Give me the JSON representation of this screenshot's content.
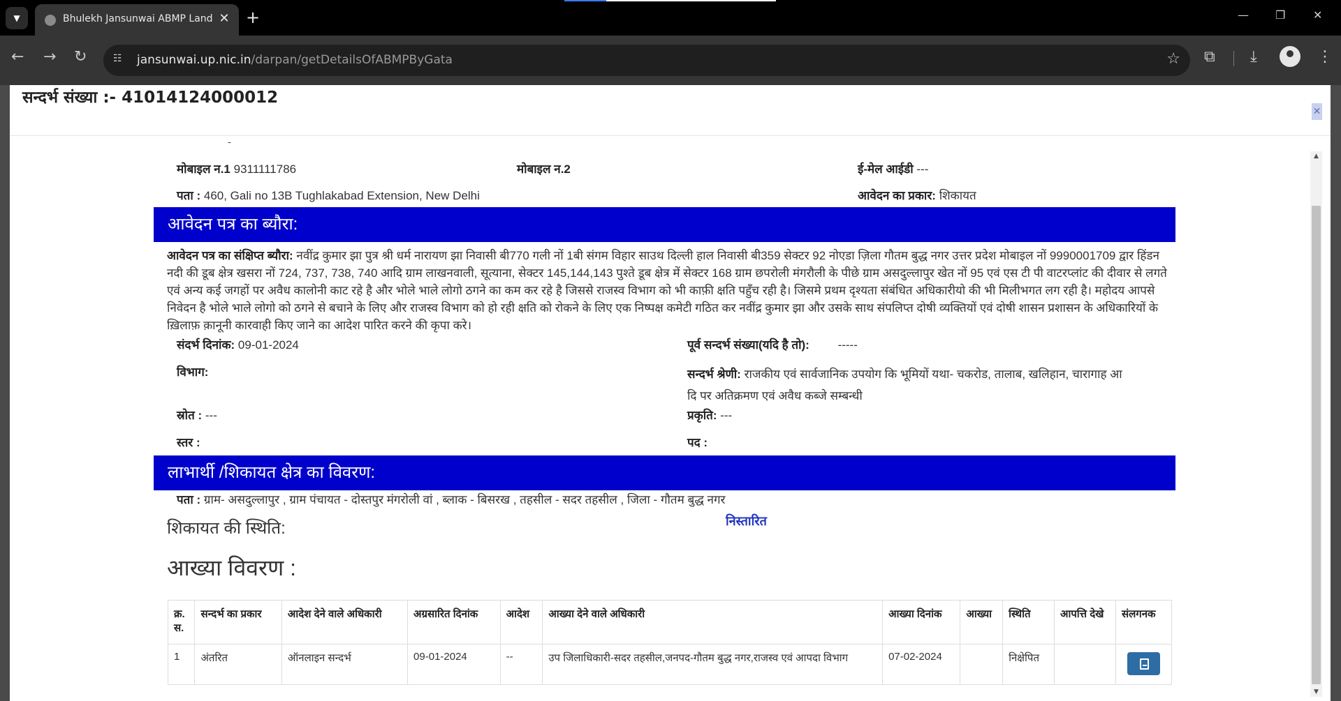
{
  "browser": {
    "tab_title": "Bhulekh Jansunwai ABMP Land",
    "tab_close": "✕",
    "new_tab": "+",
    "url_host": "jansunwai.up.nic.in",
    "url_path": "/darpan/getDetailsOfABMPByGata"
  },
  "header": {
    "reference": "सन्दर्भ संख्या :- 41014124000012",
    "close_glyph": "✕"
  },
  "contact": {
    "dash": "-",
    "mobile1_label": "मोबाइल न.1",
    "mobile1_value": "9311111786",
    "mobile2_label": "मोबाइल न.2",
    "mobile2_value": "",
    "email_label": "ई-मेल आईडी",
    "email_value": "---",
    "address_label": "पता :",
    "address_value": "460, Gali no 13B Tughlakabad Extension, New Delhi",
    "app_type_label": "आवेदन का प्रकार:",
    "app_type_value": "शिकायत"
  },
  "application": {
    "section_title": "आवेदन पत्र का ब्यौरा:",
    "summary_label": "आवेदन पत्र का संक्षिप्त ब्यौरा:",
    "summary_text": "नवींद्र कुमार झा पुत्र श्री धर्म नारायण झा निवासी बी770 गली नों 1बी संगम विहार साउथ दिल्ली हाल निवासी बी359 सेक्टर 92 नोएडा ज़िला गौतम बुद्ध नगर उत्तर प्रदेश मोबाइल नों 9990001709 द्वार हिंडन नदी की डूब क्षेत्र खसरा नों 724, 737, 738, 740 आदि ग्राम लाखनवाली, सूत्याना, सेक्टर 145,144,143 पुश्ते डूब क्षेत्र में सेक्टर 168 ग्राम छपरोली मंगरौली के पीछे ग्राम असदुल्लापुर खेत नों 95 एवं एस टी पी वाटरप्लांट की दीवार से लगते एवं अन्य कई जगहों पर अवैध कालोनी काट रहे है और भोले भाले लोगो ठगने का कम कर रहे है जिससे राजस्व विभाग को भी काफ़ी क्षति पहुँच रही है। जिसमे प्रथम दृश्यता संबंधित अधिकारीयो की भी मिलीभगत लग रही है। महोदय आपसे निवेदन है भोले भाले लोगो को ठगने से बचाने के लिए और राजस्व विभाग को हो रही क्षति को रोकने के लिए एक निष्पक्ष कमेटी गठित कर नवींद्र कुमार झा और उसके साथ संपलिप्त दोषी व्यक्तियों एवं दोषी शासन प्रशासन के अधिकारियों के ख़िलाफ़ क़ानूनी कारवाही किए जाने का आदेश पारित करने की कृपा करे।",
    "ref_date_label": "संदर्भ दिनांक:",
    "ref_date_value": "09-01-2024",
    "prev_ref_label": "पूर्व सन्दर्भ संख्या(यदि है तो):",
    "prev_ref_value": "-----",
    "dept_label": "विभाग:",
    "dept_value": "",
    "category_label": "सन्दर्भ श्रेणी:",
    "category_line1": "राजकीय एवं सार्वजानिक उपयोग कि भूमियों यथा- चकरोड, तालाब, खलिहान, चारागाह आ",
    "category_line2": "दि पर अतिक्रमण एवं अवैध कब्जे सम्बन्धी",
    "source_label": "स्रोत :",
    "source_value": "---",
    "nature_label": "प्रकृति:",
    "nature_value": "---",
    "level_label": "स्तर :",
    "level_value": "",
    "post_label": "पद :",
    "post_value": ""
  },
  "beneficiary": {
    "section_title": "लाभार्थी /शिकायत क्षेत्र का विवरण:",
    "address_label": "पता :",
    "address_value": "ग्राम- असदुल्लापुर , ग्राम पंचायत - दोस्तपुर मंगरोली वां , ब्लाक - बिसरख , तहसील - सदर तहसील , जिला - गौतम बुद्ध नगर",
    "status_label": "शिकायत की स्थिति:",
    "status_value": "निस्तारित"
  },
  "akhya": {
    "title": "आख्या विवरण :",
    "headers": [
      "क्र. स.",
      "सन्दर्भ का प्रकार",
      "आदेश देने वाले अधिकारी",
      "अग्रसारित दिनांक",
      "आदेश",
      "आख्या देने वाले अधिकारी",
      "आख्या दिनांक",
      "आख्या",
      "स्थिति",
      "आपत्ति देखे",
      "संलगनक"
    ],
    "rows": [
      {
        "sno": "1",
        "ref_type": "अंतरित",
        "order_officer": "ऑनलाइन सन्दर्भ",
        "forward_date": "09-01-2024",
        "order": "--",
        "report_officer": "उप जिलाधिकारी-सदर तहसील,जनपद-गौतम बुद्ध नगर,राजस्व एवं आपदा विभाग",
        "report_date": "07-02-2024",
        "report": "",
        "status": "निक्षेपित",
        "objection": ""
      }
    ]
  },
  "colors": {
    "band": "#0000cc",
    "status_link": "#2033c0",
    "status_green": "#2a8a2a",
    "pdf_button": "#2e6da4"
  },
  "icons": [
    "site-info-icon",
    "star-icon",
    "extensions-icon",
    "download-icon",
    "profile-icon",
    "menu-icon",
    "pdf-icon"
  ]
}
